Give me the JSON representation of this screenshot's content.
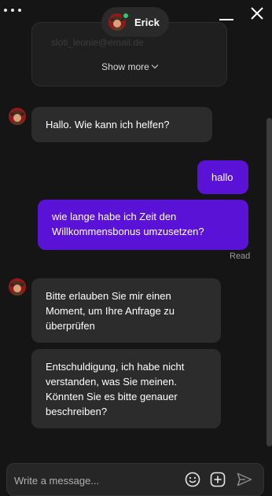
{
  "header": {
    "agent_name": "Erick",
    "agent_status": "online"
  },
  "previous_card": {
    "faded_text": "sloti_leonie@email.de",
    "show_more_label": "Show more"
  },
  "messages": [
    {
      "sender": "agent",
      "text": "Hallo. Wie kann ich helfen?"
    },
    {
      "sender": "user",
      "text": "hallo"
    },
    {
      "sender": "user",
      "text": "wie lange habe ich Zeit den Willkommensbonus umzusetzen?"
    },
    {
      "sender": "agent",
      "text": "Bitte erlauben Sie mir einen Moment, um Ihre Anfrage zu überprüfen"
    },
    {
      "sender": "agent",
      "text": "Entschuldigung, ich habe nicht verstanden, was Sie meinen. Könnten Sie es bitte genauer beschreiben?"
    }
  ],
  "read_receipt": "Read",
  "composer": {
    "placeholder": "Write a message..."
  },
  "icons": {
    "menu": "more-dots-icon",
    "minimize": "minimize-icon",
    "close": "close-icon",
    "emoji": "emoji-icon",
    "add": "add-icon",
    "send": "send-icon"
  },
  "colors": {
    "background": "#151515",
    "agent_bubble": "#2c2c2c",
    "user_bubble": "#5a12d6",
    "online": "#2ecc71"
  }
}
